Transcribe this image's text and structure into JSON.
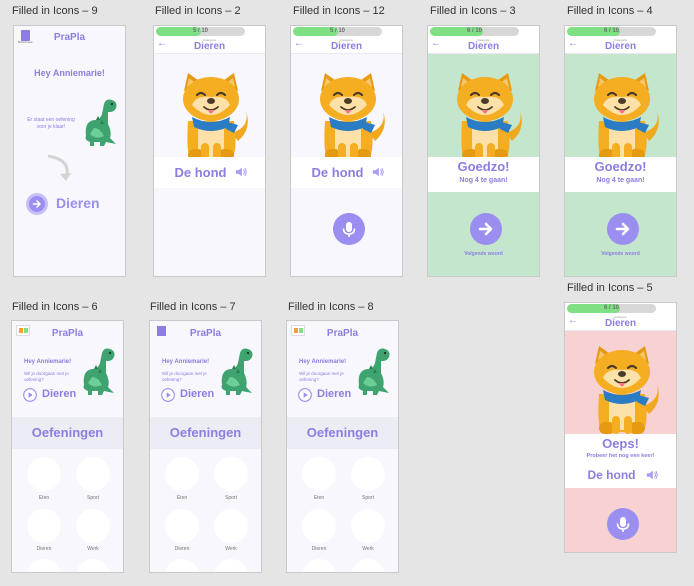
{
  "app": {
    "name": "PraPla",
    "logo_caption": "Bibliotheek"
  },
  "colors": {
    "accent": "#8c7ee0",
    "button": "#9a8ff0",
    "progress": "#7ee083",
    "correct_bg": "#c3e6cc",
    "wrong_bg": "#f8d2d2"
  },
  "frames": {
    "f9": {
      "label": "Filled in Icons – 9",
      "greeting": "Hey Anniemarie!",
      "bubble": "Er staat een oefening voor je klaar!",
      "category": "Dieren"
    },
    "f2": {
      "label": "Filled in Icons – 2",
      "progress_text": "5 / 10",
      "progress": 0.5,
      "cat_small": "Categorie",
      "category": "Dieren",
      "word": "De hond"
    },
    "f12": {
      "label": "Filled in Icons – 12",
      "progress_text": "5 / 10",
      "progress": 0.5,
      "cat_small": "Categorie",
      "category": "Dieren",
      "word": "De hond"
    },
    "f3": {
      "label": "Filled in Icons – 3",
      "progress_text": "6 / 10",
      "progress": 0.6,
      "cat_small": "Categorie",
      "category": "Dieren",
      "title": "Goedzo!",
      "sub": "Nog 4 te gaan!",
      "next": "Volgende woord"
    },
    "f4": {
      "label": "Filled in Icons – 4",
      "progress_text": "6 / 10",
      "progress": 0.6,
      "cat_small": "Categorie",
      "category": "Dieren",
      "title": "Goedzo!",
      "sub": "Nog 4 te gaan!",
      "next": "Volgende woord"
    },
    "f5": {
      "label": "Filled in Icons – 5",
      "progress_text": "6 / 10",
      "progress": 0.6,
      "cat_small": "Categorie",
      "category": "Dieren",
      "title": "Oeps!",
      "sub": "Probeer het nog een keer!",
      "word": "De hond"
    },
    "f6": {
      "label": "Filled in Icons – 6",
      "greeting": "Hey Anniemarie!",
      "question": "Wil je doorgaan met je oefening?",
      "category": "Dieren",
      "oefeningen": "Oefeningen",
      "tiles": [
        "Eten",
        "Sport",
        "Dieren",
        "Werk"
      ]
    },
    "f7": {
      "label": "Filled in Icons – 7",
      "greeting": "Hey Anniemarie!",
      "question": "Wil je doorgaan met je oefening?",
      "category": "Dieren",
      "oefeningen": "Oefeningen",
      "tiles": [
        "Eten",
        "Sport",
        "Dieren",
        "Werk"
      ]
    },
    "f8": {
      "label": "Filled in Icons – 8",
      "greeting": "Hey Anniemarie!",
      "question": "Wil je doorgaan met je oefening?",
      "category": "Dieren",
      "oefeningen": "Oefeningen",
      "tiles": [
        "Eten",
        "Sport",
        "Dieren",
        "Werk"
      ]
    }
  }
}
